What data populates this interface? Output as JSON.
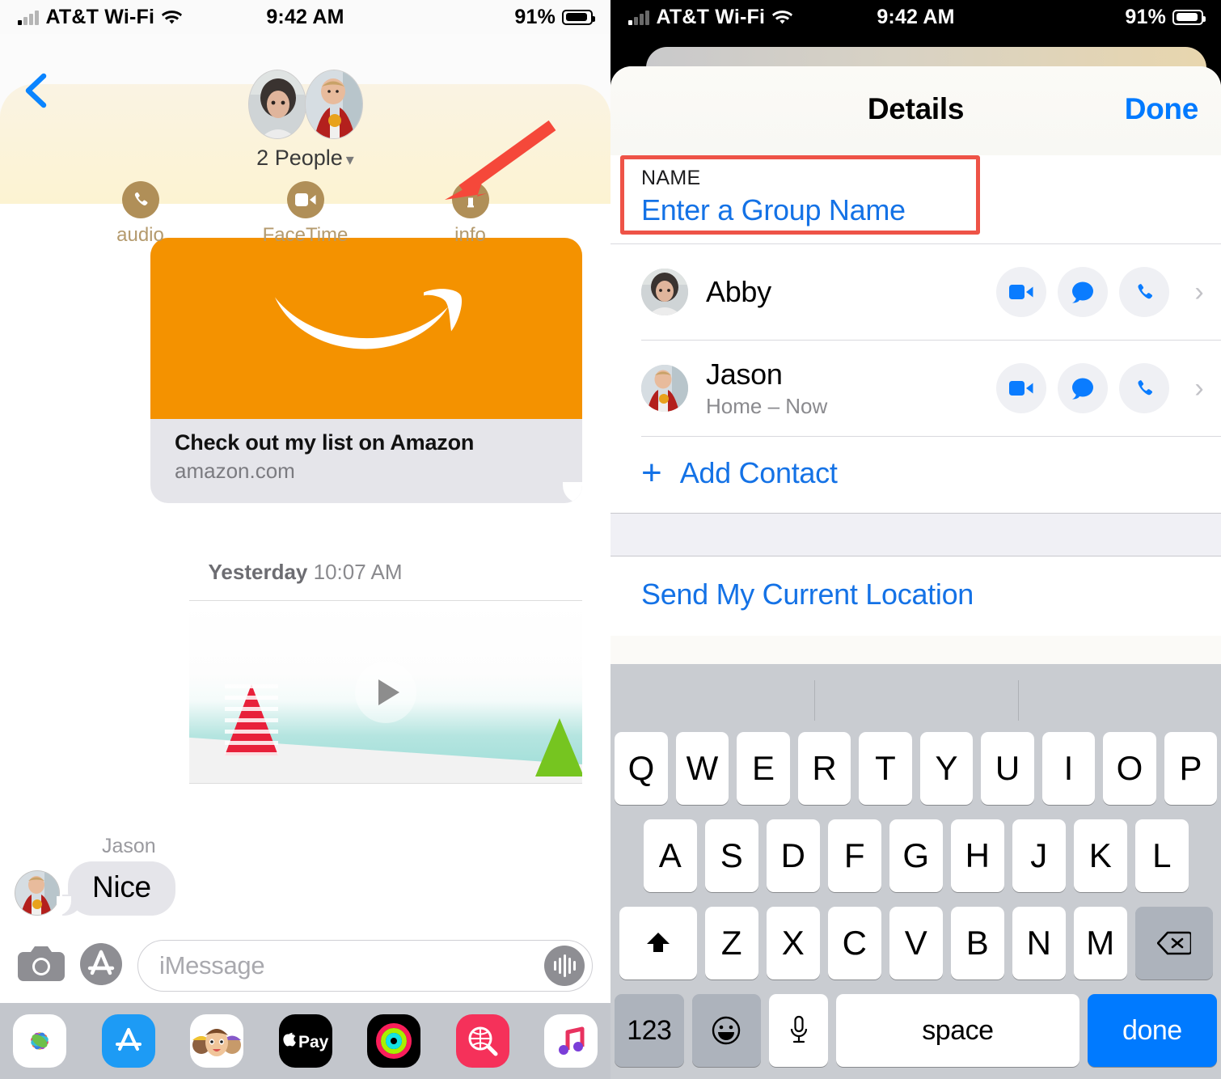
{
  "status_bar": {
    "carrier": "AT&T Wi-Fi",
    "time": "9:42 AM",
    "battery": "91%"
  },
  "left_panel": {
    "header": {
      "back_icon": "chevron-left-icon",
      "participants_label": "2 People",
      "disclosure_icon": "chevron-down-icon",
      "actions": [
        {
          "label": "audio",
          "icon": "phone-icon"
        },
        {
          "label": "FaceTime",
          "icon": "video-camera-icon"
        },
        {
          "label": "info",
          "icon": "info-icon"
        }
      ],
      "annotation": {
        "type": "red-arrow",
        "points_to": "info"
      },
      "accent_color": "#b08f58",
      "panel_color": "#fdf2cf"
    },
    "thread": {
      "link_preview": {
        "title": "Check out my list on Amazon",
        "url": "amazon.com",
        "brand_color": "#f49200",
        "logo": "amazon-smile-icon"
      },
      "timestamp_day": "Yesterday",
      "timestamp_time": "10:07 AM",
      "video_message": {
        "play_icon": "play-icon"
      },
      "incoming_message": {
        "sender": "Jason",
        "text": "Nice"
      }
    },
    "composer": {
      "camera_icon": "camera-icon",
      "appstore_icon": "app-store-icon",
      "placeholder": "iMessage",
      "audio_icon": "audio-waveform-icon"
    },
    "app_dock": [
      {
        "name": "photos-app-icon"
      },
      {
        "name": "app-store-app-icon"
      },
      {
        "name": "memoji-app-icon"
      },
      {
        "name": "apple-pay-app-icon",
        "label": "Pay"
      },
      {
        "name": "activity-app-icon"
      },
      {
        "name": "images-search-app-icon"
      },
      {
        "name": "music-app-icon"
      }
    ]
  },
  "right_panel": {
    "sheet": {
      "title": "Details",
      "done_label": "Done",
      "done_color": "#007aff"
    },
    "name_section": {
      "label": "NAME",
      "value": "Enter a Group Name",
      "highlight_color": "#ee5347"
    },
    "contacts": [
      {
        "name": "Abby",
        "subtitle": "",
        "actions": [
          "video-camera-icon",
          "message-bubble-icon",
          "phone-icon"
        ],
        "chevron": "chevron-right-icon"
      },
      {
        "name": "Jason",
        "subtitle": "Home – Now",
        "actions": [
          "video-camera-icon",
          "message-bubble-icon",
          "phone-icon"
        ],
        "chevron": "chevron-right-icon"
      }
    ],
    "add_contact": {
      "icon": "plus-icon",
      "label": "Add Contact"
    },
    "send_location": {
      "label": "Send My Current Location"
    },
    "keyboard": {
      "row1": [
        "Q",
        "W",
        "E",
        "R",
        "T",
        "Y",
        "U",
        "I",
        "O",
        "P"
      ],
      "row2": [
        "A",
        "S",
        "D",
        "F",
        "G",
        "H",
        "J",
        "K",
        "L"
      ],
      "row3": [
        "Z",
        "X",
        "C",
        "V",
        "B",
        "N",
        "M"
      ],
      "shift_icon": "shift-arrow-icon",
      "delete_icon": "backspace-icon",
      "numbers_label": "123",
      "emoji_icon": "smiley-icon",
      "mic_icon": "microphone-icon",
      "space_label": "space",
      "return_label": "done"
    }
  }
}
